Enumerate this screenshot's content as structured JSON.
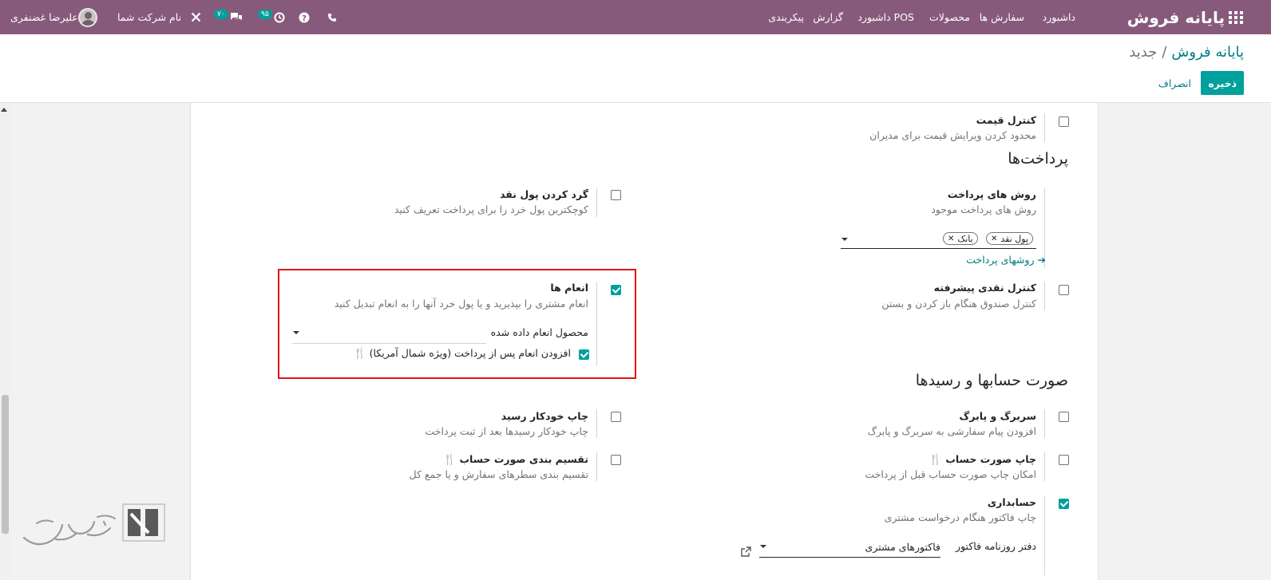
{
  "navbar": {
    "app_title": "پایانه فروش",
    "menu": [
      "داشبورد",
      "سفارش ها",
      "محصولات",
      "داشبورد POS",
      "گزارش",
      "پیکربندی"
    ],
    "company": "نام شرکت شما",
    "user": "علیرضا غضنفری",
    "activity_count": "۹۵",
    "messages_count": "۷۰",
    "icons": [
      "apps-icon",
      "phone-icon",
      "help-icon",
      "clock-icon",
      "chat-icon",
      "tools-icon"
    ]
  },
  "breadcrumb": {
    "parent": "پایانه فروش",
    "separator": "/",
    "current": "جدید"
  },
  "actions": {
    "save": "ذخیره",
    "discard": "انصراف"
  },
  "settings": {
    "price_control": {
      "label": "کنترل قیمت",
      "desc": "محدود کردن ویرایش قیمت برای مدیران",
      "checked": false
    },
    "payments_title": "پرداخت‌ها",
    "payment_methods": {
      "label": "روش های پرداخت",
      "desc": "روش های پرداخت موجود",
      "tags": [
        "پول نقد",
        "بانک"
      ],
      "link": "روشهای پرداخت"
    },
    "cash_rounding": {
      "label": "گرد کردن پول نقد",
      "desc": "کوچکترین پول خرد را برای پرداخت تعریف کنید",
      "checked": false
    },
    "advanced_cash": {
      "label": "کنترل نقدی پیشرفته",
      "desc": "کنترل صندوق هنگام باز کردن و بستن",
      "checked": false
    },
    "tips": {
      "label": "انعام ها",
      "desc": "انعام مشتری را بپذیرید و یا پول خرد آنها را به انعام تبدیل کنید",
      "product_label": "محصول انعام داده شده",
      "after_payment": "افزودن انعام پس از پرداخت (ویژه شمال آمریکا)",
      "checked": true,
      "after_payment_checked": true
    },
    "bills_title": "صورت حسابها و رسیدها",
    "header_footer": {
      "label": "سربرگ و پابرگ",
      "desc": "افزودن پیام سفارشی به سربرگ و پابرگ",
      "checked": false
    },
    "auto_print": {
      "label": "چاپ خودکار رسید",
      "desc": "چاپ خودکار رسیدها بعد از ثبت پرداخت",
      "checked": false
    },
    "print_bill": {
      "label": "چاپ صورت حساب",
      "desc": "امکان چاپ صورت حساب قبل از پرداخت",
      "checked": false
    },
    "split_bill": {
      "label": "تقسیم بندی صورت حساب",
      "desc": "تقسیم بندی سطرهای سفارش و یا جمع کل",
      "checked": false
    },
    "accounting": {
      "label": "حسابداری",
      "desc": "چاپ فاکتور هنگام درخواست مشتری",
      "checked": true,
      "journal_label": "دفتر روزنامه فاکتور",
      "journal_value": "فاکتورهای مشتری"
    }
  },
  "colors": {
    "navbar": "#875a7b",
    "primary": "#00a09d",
    "link": "#017e84",
    "highlight": "#e3151a"
  }
}
